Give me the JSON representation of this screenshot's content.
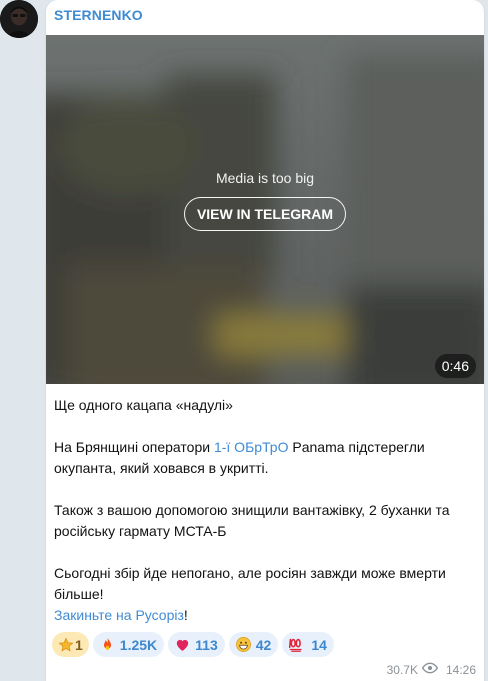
{
  "channel": {
    "name": "STERNENKO"
  },
  "media": {
    "note": "Media is too big",
    "button_label": "VIEW IN TELEGRAM",
    "duration": "0:46"
  },
  "post": {
    "line1": "Ще одного кацапа «надулі»",
    "p2_before": "На Брянщині оператори ",
    "p2_link": "1-ї ОБрТрО",
    "p2_after": " Panama підстерегли окупанта, який ховався в укритті.",
    "p3": "Також з вашою допомогою знищили вантажівку, 2 буханки та російську гармату МСТА-Б",
    "p4": "Сьогодні збір йде непогано, але росіян завжди може вмерти більше!",
    "p5_link": "Закиньте на Русоріз",
    "p5_after": "!"
  },
  "reactions": [
    {
      "icon": "star-icon",
      "count": "1"
    },
    {
      "icon": "fire-icon",
      "count": "1.25K"
    },
    {
      "icon": "heart-icon",
      "count": "113"
    },
    {
      "icon": "grin-face-icon",
      "count": "42"
    },
    {
      "icon": "hundred-icon",
      "count": "14"
    }
  ],
  "meta": {
    "views": "30.7K",
    "time": "14:26"
  },
  "colors": {
    "accent": "#3f8bd3",
    "background": "#dfe7ec",
    "reaction_bg": "#e8f1fb",
    "star_bg": "#fde9b6"
  }
}
